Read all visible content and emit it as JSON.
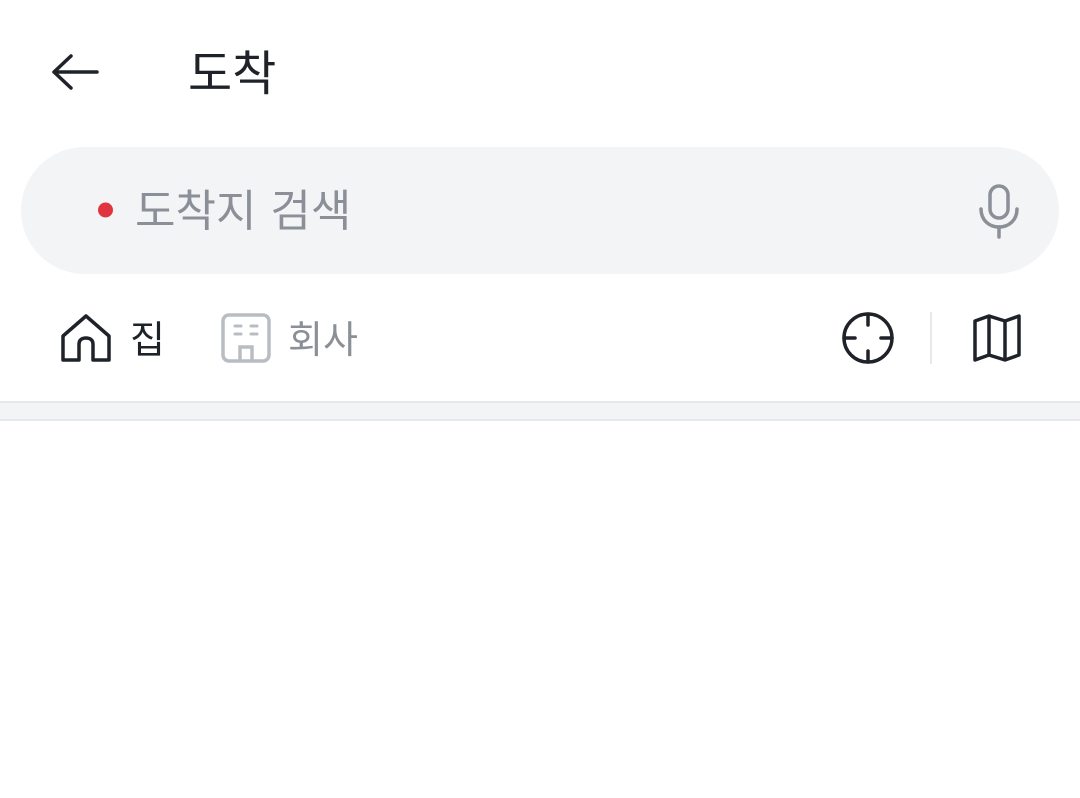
{
  "header": {
    "title": "도착",
    "back_icon": "arrow-left-icon"
  },
  "search": {
    "placeholder": "도착지 검색",
    "value": "",
    "dot_color": "#e0343f",
    "mic_icon": "microphone-icon"
  },
  "shortcuts": {
    "home": {
      "label": "집",
      "icon": "home-icon"
    },
    "company": {
      "label": "회사",
      "icon": "building-icon"
    }
  },
  "actions": {
    "gps_icon": "crosshair-icon",
    "map_icon": "map-icon"
  }
}
